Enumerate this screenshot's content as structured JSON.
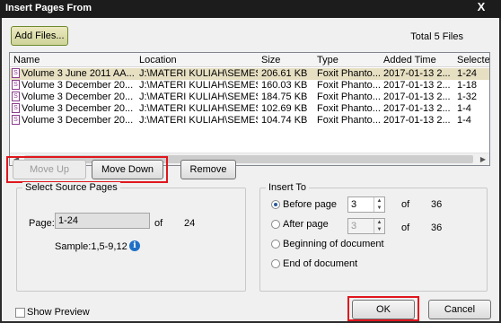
{
  "window": {
    "title": "Insert Pages From",
    "close_glyph": "X"
  },
  "toolbar": {
    "add_files_label": "Add Files...",
    "total_files": "Total 5 Files"
  },
  "file_list": {
    "columns": [
      "Name",
      "Location",
      "Size",
      "Type",
      "Added Time",
      "Selected"
    ],
    "rows": [
      [
        "Volume 3 June 2011 AA...",
        "J:\\MATERI KULIAH\\SEMES...",
        "206.61 KB",
        "Foxit Phanto...",
        "2017-01-13 2...",
        "1-24"
      ],
      [
        "Volume 3 December 20...",
        "J:\\MATERI KULIAH\\SEMES...",
        "160.03 KB",
        "Foxit Phanto...",
        "2017-01-13 2...",
        "1-18"
      ],
      [
        "Volume 3 December 20...",
        "J:\\MATERI KULIAH\\SEMES...",
        "184.75 KB",
        "Foxit Phanto...",
        "2017-01-13 2...",
        "1-32"
      ],
      [
        "Volume 3 December 20...",
        "J:\\MATERI KULIAH\\SEMES...",
        "102.69 KB",
        "Foxit Phanto...",
        "2017-01-13 2...",
        "1-4"
      ],
      [
        "Volume 3 December 20...",
        "J:\\MATERI KULIAH\\SEMES...",
        "104.74 KB",
        "Foxit Phanto...",
        "2017-01-13 2...",
        "1-4"
      ]
    ],
    "selected_row": 0
  },
  "actions": {
    "move_up": "Move Up",
    "move_down": "Move Down",
    "remove": "Remove"
  },
  "source_pages": {
    "legend": "Select Source Pages",
    "page_label": "Page:",
    "page_value": "1-24",
    "of_label": "of",
    "page_total": "24",
    "sample": "Sample:1,5-9,12"
  },
  "insert_to": {
    "legend": "Insert To",
    "before_label": "Before page",
    "before_value": "3",
    "after_label": "After page",
    "after_value": "3",
    "of_label": "of",
    "before_total": "36",
    "after_total": "36",
    "beginning_label": "Beginning of document",
    "end_label": "End of document",
    "selected_option": "Before page"
  },
  "footer": {
    "show_preview": "Show Preview",
    "ok": "OK",
    "cancel": "Cancel"
  },
  "colors": {
    "highlight": "#e0161d",
    "selected_row": "#e6dfc2"
  }
}
